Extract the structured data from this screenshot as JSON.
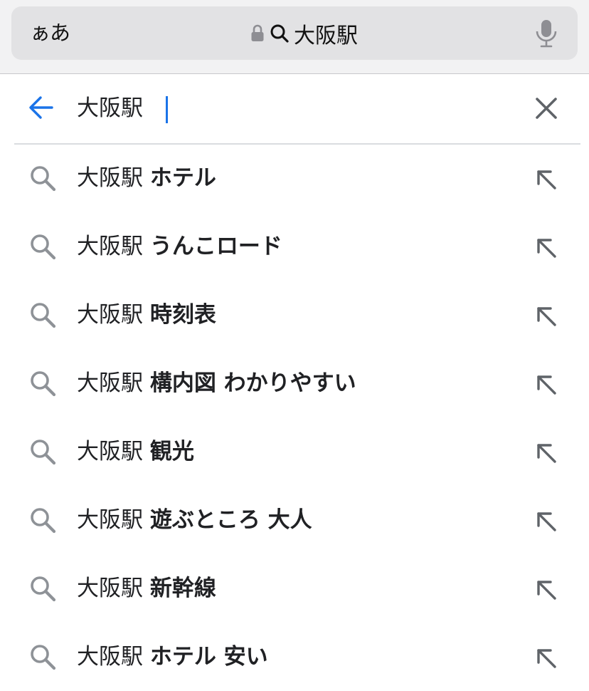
{
  "browser": {
    "aa_label": "ぁあ",
    "url_text": "大阪駅"
  },
  "search": {
    "query": "大阪駅"
  },
  "suggestions": [
    {
      "prefix": "大阪駅",
      "suffix": "ホテル"
    },
    {
      "prefix": "大阪駅",
      "suffix": "うんこロード"
    },
    {
      "prefix": "大阪駅",
      "suffix": "時刻表"
    },
    {
      "prefix": "大阪駅",
      "suffix": "構内図 わかりやすい"
    },
    {
      "prefix": "大阪駅",
      "suffix": "観光"
    },
    {
      "prefix": "大阪駅",
      "suffix": "遊ぶところ 大人"
    },
    {
      "prefix": "大阪駅",
      "suffix": "新幹線"
    },
    {
      "prefix": "大阪駅",
      "suffix": "ホテル 安い"
    }
  ],
  "colors": {
    "accent": "#1a73e8",
    "icon_gray": "#8e9297"
  }
}
